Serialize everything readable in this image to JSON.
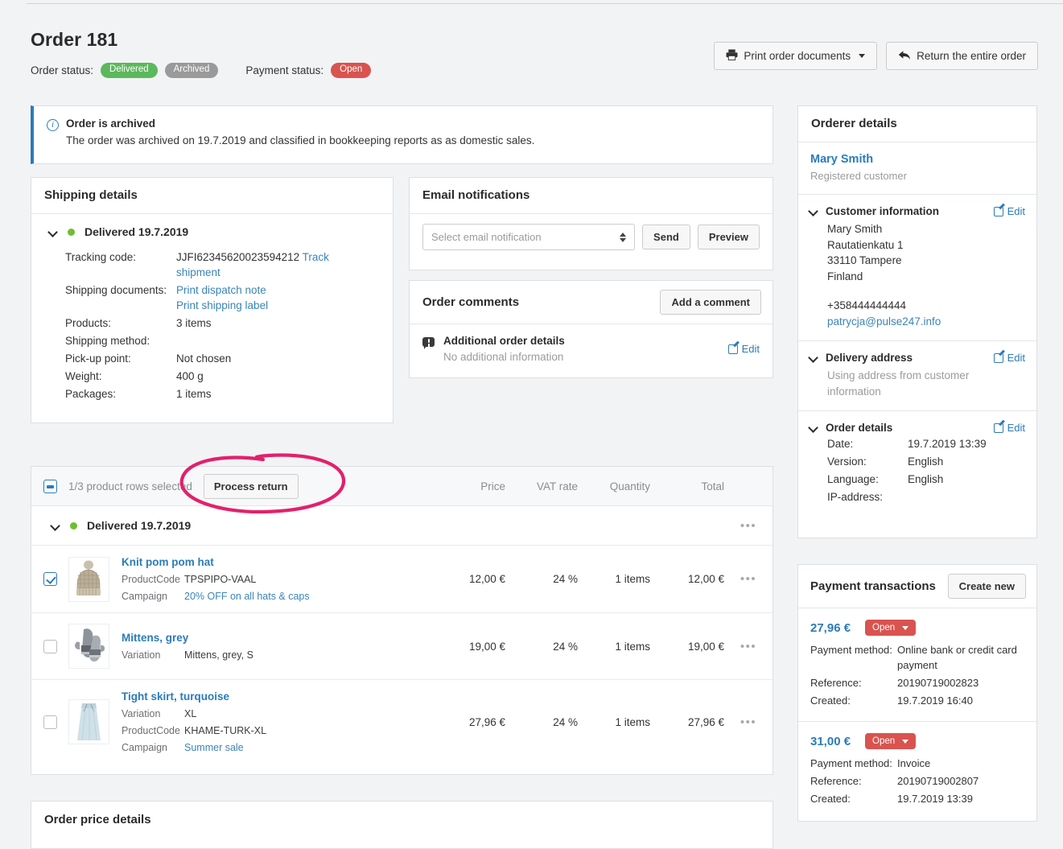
{
  "header": {
    "title": "Order 181",
    "order_status_label": "Order status:",
    "badges": [
      "Delivered",
      "Archived"
    ],
    "payment_status_label": "Payment status:",
    "payment_status": "Open",
    "print_button": "Print order documents",
    "return_button": "Return the entire order"
  },
  "alert": {
    "title": "Order is archived",
    "body": "The order was archived on 19.7.2019 and classified in bookkeeping reports as as domestic sales."
  },
  "shipping": {
    "title": "Shipping details",
    "delivered": "Delivered 19.7.2019",
    "rows": [
      {
        "key": "Tracking code:",
        "value": "JJFI62345620023594212",
        "link": "Track shipment"
      },
      {
        "key": "Shipping documents:",
        "value": "",
        "link": "Print dispatch note",
        "link2": "Print shipping label"
      },
      {
        "key": "Products:",
        "value": "3 items"
      },
      {
        "key": "Shipping method:",
        "value": ""
      },
      {
        "key": "Pick-up point:",
        "value": "Not chosen"
      },
      {
        "key": "Weight:",
        "value": "400 g"
      },
      {
        "key": "Packages:",
        "value": "1 items"
      }
    ]
  },
  "emails": {
    "title": "Email notifications",
    "select_placeholder": "Select email notification",
    "send": "Send",
    "preview": "Preview"
  },
  "comments": {
    "title": "Order comments",
    "add_button": "Add a comment",
    "item_title": "Additional order details",
    "item_sub": "No additional information",
    "edit": "Edit"
  },
  "products": {
    "selected_text": "1/3 product rows selected",
    "process_return": "Process return",
    "columns": {
      "price": "Price",
      "vat": "VAT rate",
      "quantity": "Quantity",
      "total": "Total"
    },
    "group_label": "Delivered 19.7.2019",
    "rows": [
      {
        "checked": true,
        "name": "Knit pom pom hat",
        "attrs": [
          {
            "key": "ProductCode",
            "value": "TPSPIPO-VAAL",
            "link": false
          },
          {
            "key": "Campaign",
            "value": "20% OFF on all hats & caps",
            "link": true
          }
        ],
        "price": "12,00 €",
        "vat": "24 %",
        "quantity": "1 items",
        "total": "12,00 €"
      },
      {
        "checked": false,
        "name": "Mittens, grey",
        "attrs": [
          {
            "key": "Variation",
            "value": "Mittens, grey, S",
            "link": false
          }
        ],
        "price": "19,00 €",
        "vat": "24 %",
        "quantity": "1 items",
        "total": "19,00 €"
      },
      {
        "checked": false,
        "name": "Tight skirt, turquoise",
        "attrs": [
          {
            "key": "Variation",
            "value": "XL",
            "link": false
          },
          {
            "key": "ProductCode",
            "value": "KHAME-TURK-XL",
            "link": false
          },
          {
            "key": "Campaign",
            "value": "Summer sale",
            "link": true
          }
        ],
        "price": "27,96 €",
        "vat": "24 %",
        "quantity": "1 items",
        "total": "27,96 €"
      }
    ]
  },
  "price_details": {
    "title": "Order price details"
  },
  "orderer": {
    "title": "Orderer details",
    "customer_name": "Mary Smith",
    "customer_type": "Registered customer",
    "customer_information": {
      "title": "Customer information",
      "edit": "Edit",
      "lines": [
        "Mary Smith",
        "Rautatienkatu 1",
        "33110 Tampere",
        "Finland"
      ],
      "phone": "+358444444444",
      "email": "patrycja@pulse247.info"
    },
    "delivery_address": {
      "title": "Delivery address",
      "edit": "Edit",
      "text": "Using address from customer information"
    },
    "order_details": {
      "title": "Order details",
      "edit": "Edit",
      "rows": [
        {
          "key": "Date:",
          "value": "19.7.2019 13:39"
        },
        {
          "key": "Version:",
          "value": "English"
        },
        {
          "key": "Language:",
          "value": "English"
        },
        {
          "key": "IP-address:",
          "value": ""
        }
      ]
    }
  },
  "payments": {
    "title": "Payment transactions",
    "create_new": "Create new",
    "items": [
      {
        "amount": "27,96 €",
        "status": "Open",
        "rows": [
          {
            "key": "Payment method:",
            "value": "Online bank or credit card payment"
          },
          {
            "key": "Reference:",
            "value": "20190719002823"
          },
          {
            "key": "Created:",
            "value": "19.7.2019 16:40"
          }
        ]
      },
      {
        "amount": "31,00 €",
        "status": "Open",
        "rows": [
          {
            "key": "Payment method:",
            "value": "Invoice"
          },
          {
            "key": "Reference:",
            "value": "20190719002807"
          },
          {
            "key": "Created:",
            "value": "19.7.2019 13:39"
          }
        ]
      }
    ]
  },
  "annotation": {
    "color": "#E3206B",
    "shape": "ellipse",
    "target": "process-return-button"
  },
  "colors": {
    "green": "#5cb85c",
    "gray": "#9a9a9a",
    "red": "#d9534f",
    "link": "#2b7cb9",
    "annotation": "#E3206B"
  }
}
